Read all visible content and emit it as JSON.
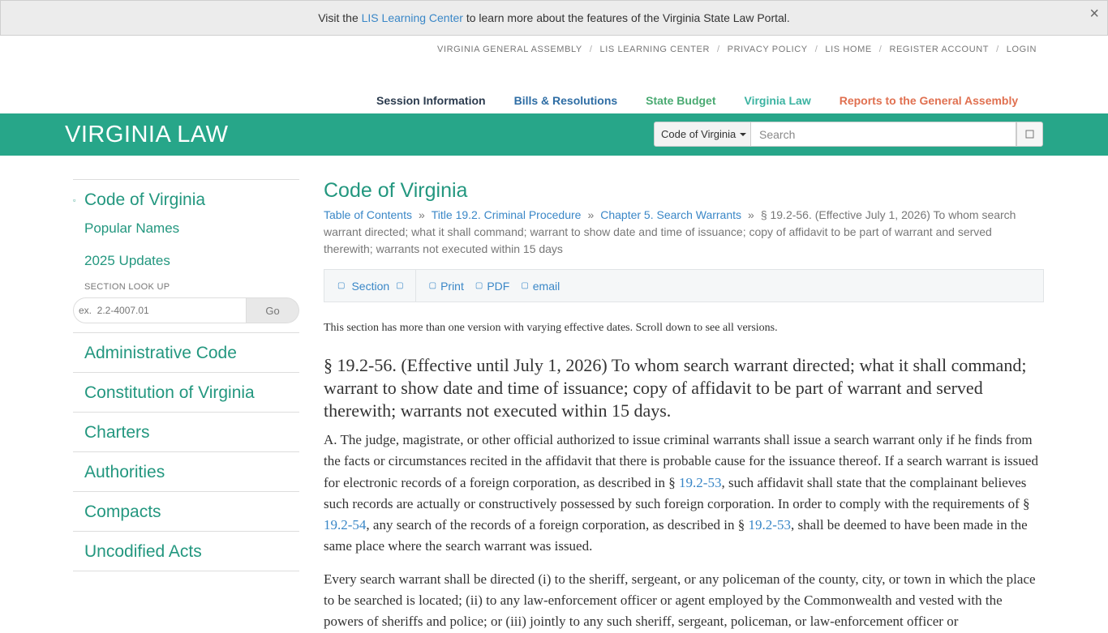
{
  "banner": {
    "text_before": "Visit the",
    "link": "LIS Learning Center",
    "text_after": "to learn more about the features of the Virginia State Law Portal.",
    "close": "×"
  },
  "utility_links": [
    "VIRGINIA GENERAL ASSEMBLY",
    "LIS LEARNING CENTER",
    "PRIVACY POLICY",
    "LIS HOME",
    "REGISTER ACCOUNT",
    "LOGIN"
  ],
  "utility_separator": "/",
  "main_nav": {
    "session": "Session Information",
    "bills": "Bills & Resolutions",
    "budget": "State Budget",
    "law": "Virginia Law",
    "reports": "Reports to the General Assembly"
  },
  "header": {
    "title": "VIRGINIA LAW",
    "search_scope": "Code of Virginia",
    "search_placeholder": "Search",
    "search_button_icon": "search-icon"
  },
  "sidebar": {
    "main": "Code of Virginia",
    "main_bullet": "▫",
    "subs": [
      "Popular Names",
      "2025 Updates"
    ],
    "lookup_label": "SECTION LOOK UP",
    "lookup_placeholder": "ex.  2.2-4007.01",
    "lookup_go": "Go",
    "items": [
      "Administrative Code",
      "Constitution of Virginia",
      "Charters",
      "Authorities",
      "Compacts",
      "Uncodified Acts"
    ]
  },
  "content": {
    "title": "Code of Virginia",
    "breadcrumb": {
      "toc": "Table of Contents",
      "title": "Title 19.2. Criminal Procedure",
      "chapter": "Chapter 5. Search Warrants",
      "separator": "»",
      "current": "§ 19.2-56. (Effective July 1, 2026) To whom search warrant directed; what it shall command; warrant to show date and time of issuance; copy of affidavit to be part of warrant and served therewith; warrants not executed within 15 days"
    },
    "toolbar": {
      "section": "Section",
      "print": "Print",
      "pdf": "PDF",
      "email": "email"
    },
    "versions_note": "This section has more than one version with varying effective dates. Scroll down to see all versions.",
    "section_heading": "§ 19.2-56. (Effective until July 1, 2026) To whom search warrant directed; what it shall command; warrant to show date and time of issuance; copy of affidavit to be part of warrant and served therewith; warrants not executed within 15 days.",
    "para_a": {
      "t1": "A. The judge, magistrate, or other official authorized to issue criminal warrants shall issue a search warrant only if he finds from the facts or circumstances recited in the affidavit that there is probable cause for the issuance thereof. If a search warrant is issued for electronic records of a foreign corporation, as described in §",
      "l1": "19.2-53",
      "t2": ", such affidavit shall state that the complainant believes such records are actually or constructively possessed by such foreign corporation. In order to comply with the requirements of §",
      "l2": "19.2-54",
      "t3": ", any search of the records of a foreign corporation, as described in §",
      "l3": "19.2-53",
      "t4": ", shall be deemed to have been made in the same place where the search warrant was issued."
    },
    "para_b": "Every search warrant shall be directed (i) to the sheriff, sergeant, or any policeman of the county, city, or town in which the place to be searched is located; (ii) to any law-enforcement officer or agent employed by the Commonwealth and vested with the powers of sheriffs and police; or (iii) jointly to any such sheriff, sergeant, policeman, or law-enforcement officer or"
  },
  "colors": {
    "header_bar": "#27a689",
    "link": "#3a87c7",
    "sidebar_link": "#23977f"
  }
}
